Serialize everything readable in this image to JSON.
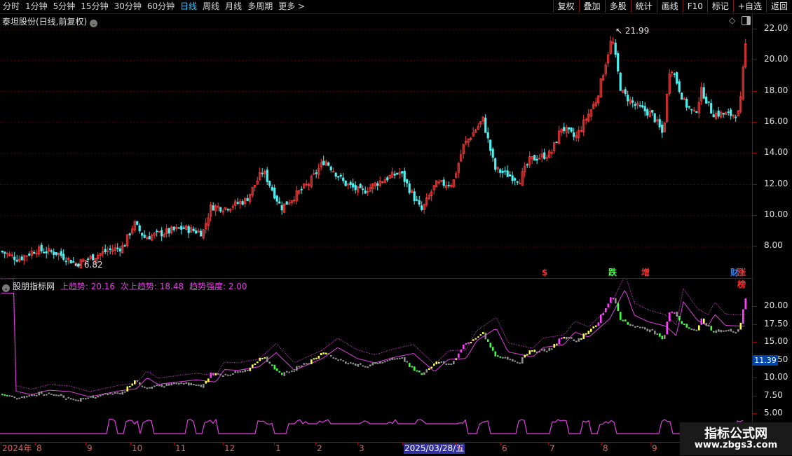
{
  "toolbar": {
    "periods": [
      "分时",
      "1分钟",
      "5分钟",
      "15分钟",
      "30分钟",
      "60分钟",
      "日线",
      "周线",
      "月线",
      "多周期",
      "更多 >"
    ],
    "active_period": "日线",
    "right_buttons": [
      "复权",
      "叠加",
      "多股",
      "统计",
      "画线",
      "F10",
      "标记",
      "+自选",
      "返回"
    ]
  },
  "main_chart": {
    "title": "泰坦股份(日线,前复权)",
    "high_label": "21.99",
    "low_label": "6.82",
    "y_ticks": [
      "22.00",
      "20.00",
      "18.00",
      "16.00",
      "14.00",
      "12.00",
      "10.00",
      "8.00"
    ],
    "events": [
      {
        "label": "$",
        "color": "#ff3030"
      },
      {
        "label": "跌",
        "color": "#40ff40"
      },
      {
        "label": "增",
        "color": "#ff3030"
      },
      {
        "label": "财",
        "color": "#3080ff"
      },
      {
        "label": "涨榜",
        "color": "#ff3030"
      }
    ],
    "colors": {
      "up": "#ff3b3b",
      "down": "#4ff0f0"
    }
  },
  "indicator": {
    "name": "股朋指标网",
    "line1_label": "上趋势: 20.16",
    "line2_label": "次上趋势: 18.48",
    "line3_label": "趋势强度: 2.00",
    "y_ticks": [
      "20.00",
      "17.50",
      "15.00",
      "12.50",
      "10.00",
      "7.50",
      "5.00"
    ],
    "current_price": "11.39",
    "colors": {
      "trend": "#e040e0",
      "strong": "#ffff40",
      "hot": "#ff40ff",
      "weak": "#40ff40",
      "neutral": "#909090"
    }
  },
  "x_axis": {
    "labels": [
      "2024年",
      "8",
      "9",
      "10",
      "11",
      "12",
      "1",
      "2",
      "3",
      "2025/03/28/五",
      "5",
      "6",
      "7",
      "8",
      "9"
    ]
  },
  "watermark": {
    "line1": "指标公式网",
    "line2": "www.zbgs3.com"
  }
}
